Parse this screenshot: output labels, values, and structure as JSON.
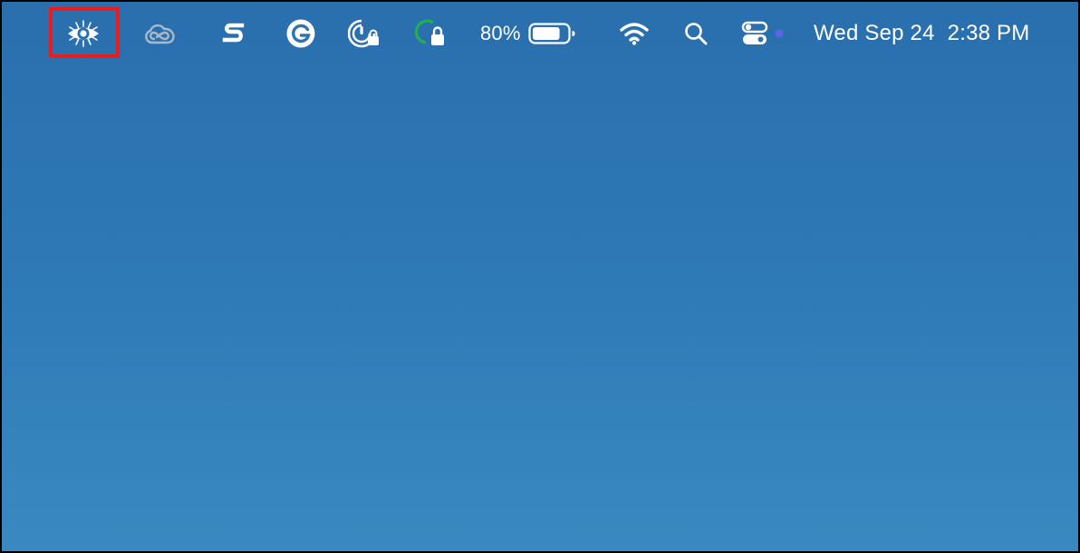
{
  "menubar": {
    "icons": {
      "vision_app": "eye-burst-icon",
      "creative_cloud": "creative-cloud-icon",
      "s_app": "s-logo-icon",
      "grammarly": "grammarly-icon",
      "lock_timer": "lock-timer-icon",
      "progress_lock": "progress-lock-icon",
      "wifi": "wifi-icon",
      "spotlight": "search-icon",
      "control_center": "control-center-icon"
    },
    "battery": {
      "percent_label": "80%",
      "level": 0.8
    },
    "clock": {
      "date": "Wed Sep 24",
      "time": "2:38 PM"
    }
  },
  "colors": {
    "desktop_top": "#2a6fae",
    "desktop_bottom": "#3a89c1",
    "highlight": "#ee1b1b",
    "progress_green": "#22b14c",
    "status_dot": "#5a66e6"
  }
}
